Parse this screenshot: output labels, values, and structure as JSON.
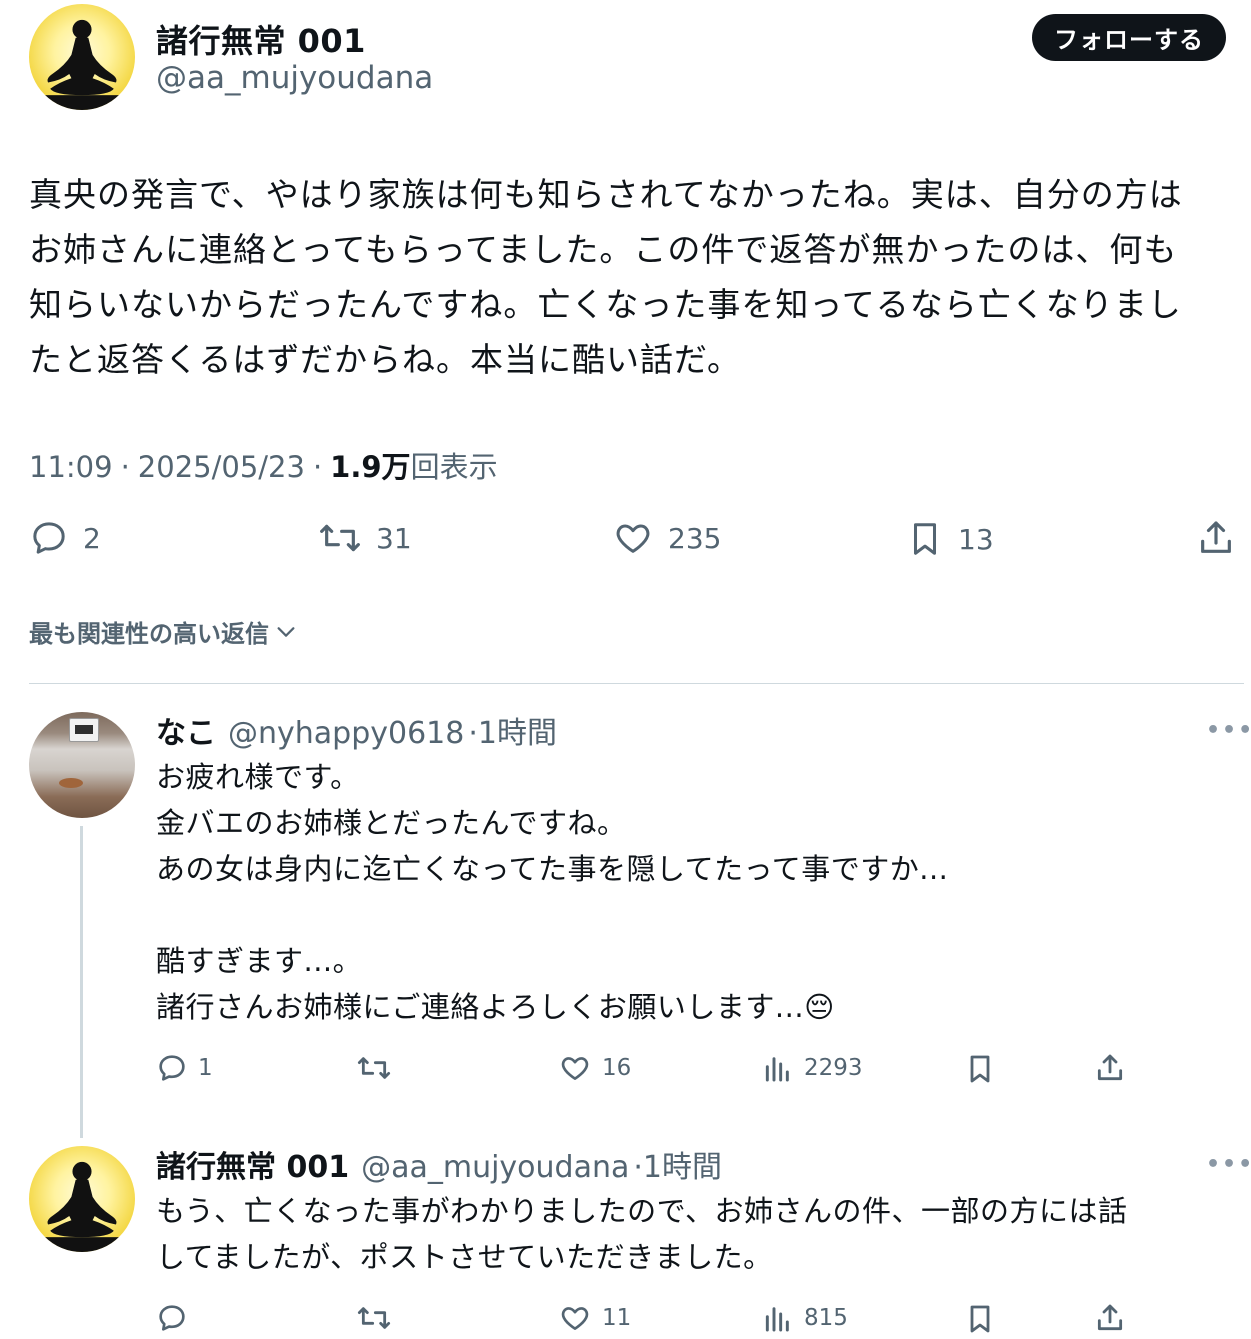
{
  "main_post": {
    "author_name": "諸行無常 001",
    "author_handle": "@aa_mujyoudana",
    "follow_label": "フォローする",
    "text_lines": [
      "真央の発言で、やはり家族は何も知らされてなかったね。実は、自分の方は",
      "お姉さんに連絡とってもらってました。この件で返答が無かったのは、何も",
      "知らいないからだったんですね。亡くなった事を知ってるなら亡くなりまし",
      "たと返答くるはずだからね。本当に酷い話だ。"
    ],
    "time": "11:09",
    "date": "2025/05/23",
    "views_count": "1.9",
    "views_unit": "万",
    "views_label": "回表示",
    "sep": "·",
    "replies": "2",
    "reposts": "31",
    "likes": "235",
    "bookmarks": "13"
  },
  "sort_label": "最も関連性の高い返信",
  "replies": [
    {
      "name": "なこ",
      "handle": "@nyhappy0618",
      "time": "·1時間",
      "text": "お疲れ様です。\n金バエのお姉様とだったんですね。\nあの女は身内に迄亡くなってた事を隠してたって事ですか...\n\n酷すぎます...。\n諸行さんお姉様にご連絡よろしくお願いします...😔",
      "replies": "1",
      "reposts": "",
      "likes": "16",
      "views": "2293"
    },
    {
      "name": "諸行無常 001",
      "handle": "@aa_mujyoudana",
      "time": "·1時間",
      "text": "もう、亡くなった事がわかりましたので、お姉さんの件、一部の方には話\nしてましたが、ポストさせていただきました。",
      "replies": "",
      "reposts": "",
      "likes": "11",
      "views": "815"
    }
  ],
  "more_label": "•••",
  "colors": {
    "text": "#0f1419",
    "secondary": "#536471",
    "border": "#cfd9de",
    "button": "#0f1419"
  }
}
